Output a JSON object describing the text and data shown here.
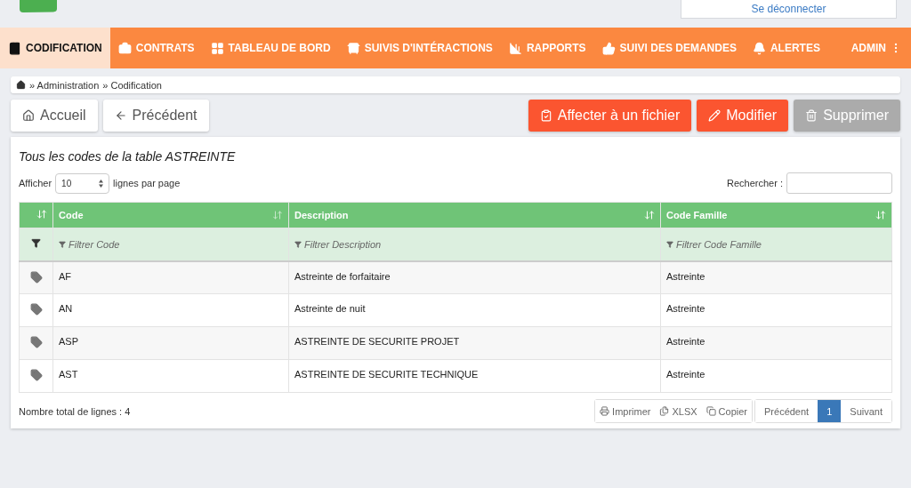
{
  "header": {
    "logout_link": "Se déconnecter"
  },
  "nav": {
    "items": [
      {
        "label": "CODIFICATION",
        "selected": true
      },
      {
        "label": "CONTRATS",
        "selected": false
      },
      {
        "label": "TABLEAU DE BORD",
        "selected": false
      },
      {
        "label": "SUIVIS D'INTÉRACTIONS",
        "selected": false
      },
      {
        "label": "RAPPORTS",
        "selected": false
      },
      {
        "label": "SUIVI DES DEMANDES",
        "selected": false
      },
      {
        "label": "ALERTES",
        "selected": false
      }
    ],
    "user": "ADMIN"
  },
  "breadcrumb": [
    "» Administration",
    "» Codification"
  ],
  "left_buttons": [
    {
      "label": "Accueil"
    },
    {
      "label": "Précédent"
    }
  ],
  "action_buttons": [
    {
      "label": "Affecter à un fichier",
      "disabled": false
    },
    {
      "label": "Modifier",
      "disabled": false
    },
    {
      "label": "Supprimer",
      "disabled": true
    }
  ],
  "card": {
    "title": "Tous les codes de la table ASTREINTE",
    "show_label": "Afficher",
    "page_size": "10",
    "per_page_label": "lignes par page",
    "search_label": "Rechercher :"
  },
  "table": {
    "columns": [
      "Code",
      "Description",
      "Code Famille"
    ],
    "filters": [
      "Filtrer Code",
      "Filtrer Description",
      "Filtrer Code Famille"
    ],
    "rows": [
      [
        "AF",
        "Astreinte de forfaitaire",
        "Astreinte"
      ],
      [
        "AN",
        "Astreinte de nuit",
        "Astreinte"
      ],
      [
        "ASP",
        "ASTREINTE DE SECURITE PROJET",
        "Astreinte"
      ],
      [
        "AST",
        "ASTREINTE DE SECURITE TECHNIQUE",
        "Astreinte"
      ]
    ]
  },
  "footer": {
    "total": "Nombre total de lignes : 4",
    "exports": [
      {
        "label": "Imprimer"
      },
      {
        "label": "XLSX"
      },
      {
        "label": "Copier"
      }
    ],
    "pagination": [
      {
        "label": "Précédent",
        "selected": false
      },
      {
        "label": "1",
        "selected": true
      },
      {
        "label": "Suivant",
        "selected": false
      }
    ]
  }
}
